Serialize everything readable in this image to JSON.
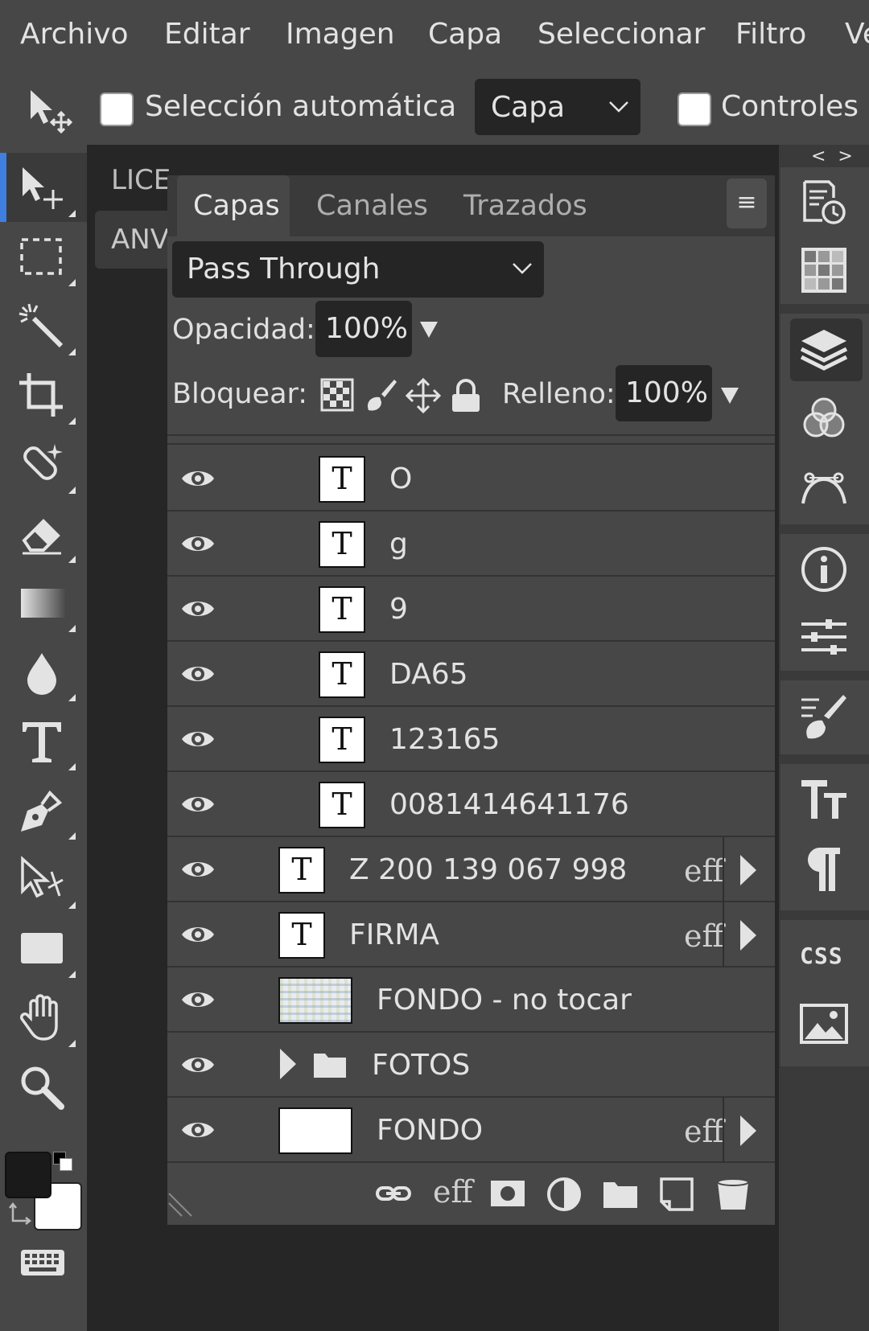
{
  "menu": [
    "Archivo",
    "Editar",
    "Imagen",
    "Capa",
    "Seleccionar",
    "Filtro",
    "Ve"
  ],
  "options": {
    "auto_select_label": "Selección automática",
    "select_value": "Capa",
    "controls_label": "Controles d"
  },
  "tools": [
    "move-tool",
    "marquee-tool",
    "magic-wand-tool",
    "crop-tool",
    "healing-tool",
    "eraser-tool",
    "gradient-tool",
    "blur-tool",
    "text-tool",
    "pen-tool",
    "path-select-tool",
    "shape-tool",
    "hand-tool",
    "zoom-tool"
  ],
  "doc_tabs": [
    "LICE",
    "ANV"
  ],
  "panel": {
    "tabs": [
      "Capas",
      "Canales",
      "Trazados"
    ],
    "menu_glyph": "≡",
    "blend_mode": "Pass Through",
    "opacity_label": "Opacidad:",
    "opacity_value": "100%",
    "lock_label": "Bloquear:",
    "fill_label": "Relleno:",
    "fill_value": "100%"
  },
  "layers": [
    {
      "name": "O",
      "type": "text"
    },
    {
      "name": "g",
      "type": "text"
    },
    {
      "name": "9",
      "type": "text"
    },
    {
      "name": "DA65",
      "type": "text"
    },
    {
      "name": "123165",
      "type": "text"
    },
    {
      "name": "0081414641176",
      "type": "text"
    },
    {
      "name": "Z 200 139 067 998",
      "type": "text",
      "eff": "eff"
    },
    {
      "name": "FIRMA",
      "type": "text",
      "eff": "eff"
    },
    {
      "name": "FONDO - no tocar",
      "type": "image"
    },
    {
      "name": "FOTOS",
      "type": "folder"
    },
    {
      "name": "FONDO",
      "type": "fill",
      "eff": "eff"
    }
  ],
  "text_thumb_glyph": "T",
  "bottom_eff": "eff",
  "right_panel_text": {
    "collapse": "< >",
    "css": "CSS"
  }
}
